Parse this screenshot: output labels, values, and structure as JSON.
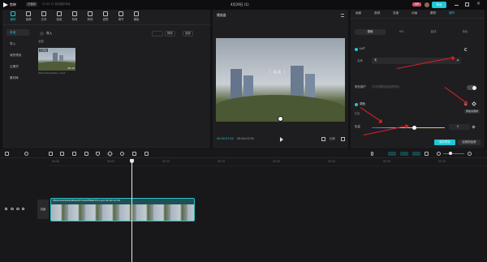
{
  "app": {
    "title": "剪映",
    "window_title": "4月29日 (1)",
    "account_label": "已保存",
    "status_text": "01:45:15 自动保存本地",
    "vip": "VIP",
    "export_label": "导出"
  },
  "toolbar": {
    "tools": [
      {
        "label": "媒体",
        "icon": "media-icon",
        "active": true
      },
      {
        "label": "音频",
        "icon": "audio-icon",
        "active": false
      },
      {
        "label": "文本",
        "icon": "text-icon",
        "active": false
      },
      {
        "label": "贴纸",
        "icon": "sticker-icon",
        "active": false
      },
      {
        "label": "特效",
        "icon": "effects-icon",
        "active": false
      },
      {
        "label": "转场",
        "icon": "transition-icon",
        "active": false
      },
      {
        "label": "滤镜",
        "icon": "filter-icon",
        "active": false
      },
      {
        "label": "调节",
        "icon": "adjust-icon",
        "active": false
      },
      {
        "label": "模板",
        "icon": "template-icon",
        "active": false
      }
    ]
  },
  "media": {
    "sidebar": [
      {
        "label": "本地",
        "active": true
      },
      {
        "label": "导入",
        "active": false
      },
      {
        "label": "我的预设",
        "active": false
      },
      {
        "label": "云素材",
        "active": false
      },
      {
        "label": "素材库",
        "active": false
      }
    ],
    "import_label": "导入",
    "section_label": "全部",
    "sort_label": "排序",
    "filter_label": "全部",
    "clip": {
      "added": "已添加",
      "name": "0fe0c22ad2b4d...mp4",
      "duration": "00:12"
    }
  },
  "player": {
    "title": "播放器",
    "current_time": "00:00:07:05",
    "total_time": "00:00:12:29",
    "overlay_text": "[ 画面 ]",
    "ratio_label": "比例"
  },
  "properties": {
    "tabs": [
      {
        "label": "画面",
        "active": false
      },
      {
        "label": "音频",
        "active": false
      },
      {
        "label": "变速",
        "active": false
      },
      {
        "label": "动画",
        "active": false
      },
      {
        "label": "跟踪",
        "active": false
      },
      {
        "label": "调节",
        "active": true
      }
    ],
    "sub_tabs": [
      {
        "label": "基础",
        "active": true
      },
      {
        "label": "HSL",
        "active": false
      },
      {
        "label": "曲线",
        "active": false
      },
      {
        "label": "色轮",
        "active": false
      }
    ],
    "lut_label": "LUT",
    "lut_name_label": "名称",
    "lut_value": "无",
    "skin_label": "肤色保护",
    "skin_hint": "(仅对调整色温色调有效)",
    "color_label": "调色",
    "tooltip": "添加关键帧",
    "auto_label": "智能",
    "temperature_label": "色温",
    "temperature_value": "0",
    "temperature_level": 0.58,
    "save_preset": "保存预设",
    "apply_all": "应用到全部"
  },
  "timeline": {
    "ruler": [
      "00:00",
      "00:05",
      "00:10",
      "00:15",
      "00:20",
      "00:25",
      "00:30",
      "00:35"
    ],
    "track_label": "封面",
    "clip_label": "0fe0c22ad2b4d462e5f7d4a7ff69b7f4.mp4  00:00:12:29"
  },
  "colors": {
    "accent": "#1fc8d4",
    "annotation": "#e02020",
    "clip": "#2ec0c7"
  }
}
